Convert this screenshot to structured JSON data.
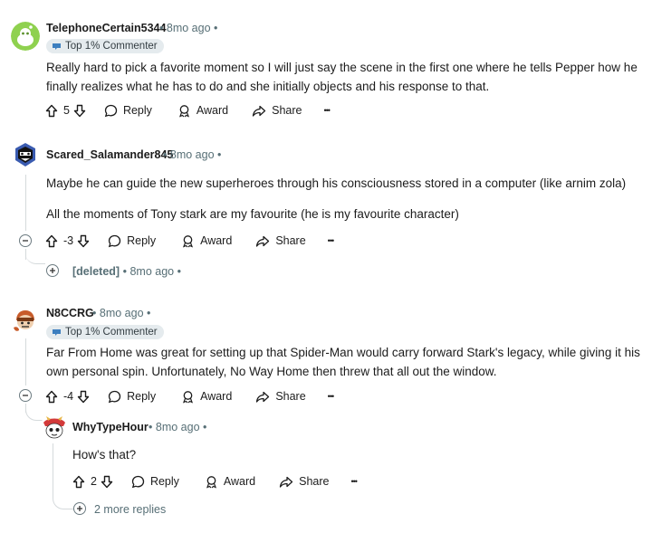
{
  "comments": [
    {
      "username": "TelephoneCertain5344",
      "time": "8mo ago",
      "badge": "Top 1% Commenter",
      "body": [
        "Really hard to pick a favorite moment so I will just say the scene in the first one where he tells Pepper how he finally realizes what he has to do and she initially objects and his response to that."
      ],
      "votes": "5"
    },
    {
      "username": "Scared_Salamander845",
      "time": "8mo ago",
      "body": [
        "Maybe he can guide the new superheroes through his consciousness stored in a computer (like arnim zola)",
        "All the moments of Tony stark are my favourite (he is my favourite character)"
      ],
      "votes": "-3"
    },
    {
      "username": "N8CCRG",
      "time": "8mo ago",
      "badge": "Top 1% Commenter",
      "body": [
        "Far From Home was great for setting up that Spider-Man would carry forward Stark's legacy, while giving it his own personal spin. Unfortunately, No Way Home then threw that all out the window."
      ],
      "votes": "-4"
    },
    {
      "username": "WhyTypeHour",
      "time": "8mo ago",
      "body": [
        "How's that?"
      ],
      "votes": "2"
    }
  ],
  "deleted": {
    "label": "[deleted]",
    "time": "8mo ago"
  },
  "more_replies": "2 more replies",
  "actions": {
    "reply": "Reply",
    "award": "Award",
    "share": "Share",
    "more": "•••"
  },
  "separator": "•",
  "icons": [
    "upvote-icon",
    "downvote-icon",
    "reply-icon",
    "award-icon",
    "share-icon",
    "badge-icon",
    "collapse-icon",
    "expand-icon"
  ]
}
